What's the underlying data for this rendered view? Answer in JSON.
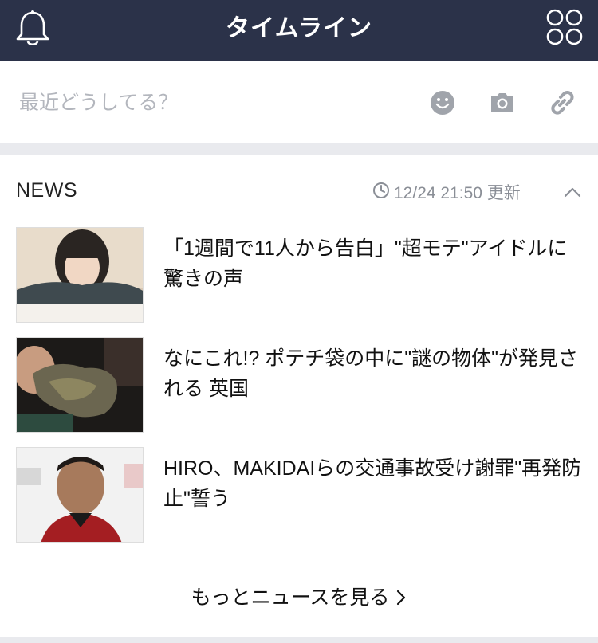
{
  "header": {
    "title": "タイムライン",
    "left_icon": "bell-icon",
    "right_icon": "services-grid-icon"
  },
  "compose": {
    "placeholder": "最近どうしてる？",
    "icons": [
      "emoji-icon",
      "camera-icon",
      "link-icon"
    ]
  },
  "news": {
    "label": "NEWS",
    "timestamp": "12/24 21:50 更新",
    "collapse_icon": "chevron-up-icon",
    "items": [
      {
        "headline": "「1週間で11人から告白」\"超モテ\"アイドルに驚きの声",
        "thumb": "idol-photo"
      },
      {
        "headline": "なにこれ!? ポテチ袋の中に\"謎の物体\"が発見される 英国",
        "thumb": "object-photo"
      },
      {
        "headline": "HIRO、MAKIDAIらの交通事故受け謝罪\"再発防止\"誓う",
        "thumb": "man-photo"
      }
    ],
    "more_label": "もっとニュースを見る"
  },
  "colors": {
    "header_bg": "#2b3249",
    "page_bg": "#e9eaee",
    "icon_gray": "#a0a4ab"
  }
}
